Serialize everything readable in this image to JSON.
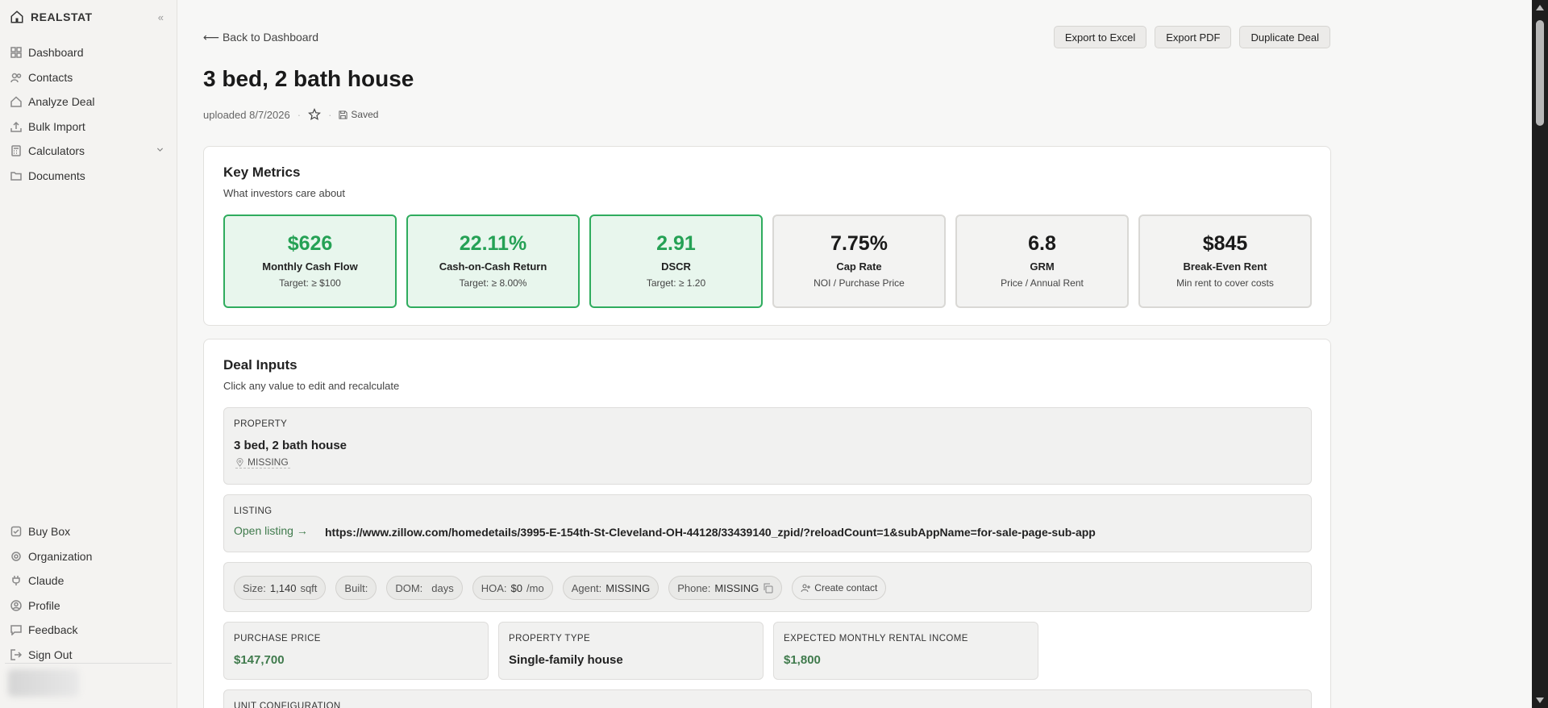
{
  "sidebar": {
    "brand": "REALSTAT",
    "collapse_glyph": "«",
    "top_items": [
      {
        "label": "Dashboard",
        "icon": "grid-icon"
      },
      {
        "label": "Contacts",
        "icon": "users-icon"
      },
      {
        "label": "Analyze Deal",
        "icon": "home-icon"
      },
      {
        "label": "Bulk Import",
        "icon": "upload-icon"
      },
      {
        "label": "Calculators",
        "icon": "calculator-icon"
      },
      {
        "label": "Documents",
        "icon": "folder-icon"
      }
    ],
    "bottom_items": [
      {
        "label": "Buy Box",
        "icon": "checkbox-icon"
      },
      {
        "label": "Organization",
        "icon": "gear-icon"
      },
      {
        "label": "Claude",
        "icon": "plug-icon"
      },
      {
        "label": "Profile",
        "icon": "user-circle-icon"
      },
      {
        "label": "Feedback",
        "icon": "message-icon"
      },
      {
        "label": "Sign Out",
        "icon": "logout-icon"
      }
    ]
  },
  "header": {
    "back": "⟵ Back to Dashboard",
    "buttons": [
      "Export to Excel",
      "Export PDF",
      "Duplicate Deal"
    ],
    "title": "3 bed, 2 bath house",
    "uploaded": "uploaded 8/7/2026",
    "saved": "Saved"
  },
  "key_metrics": {
    "title": "Key Metrics",
    "subtitle": "What investors care about",
    "items": [
      {
        "value": "$626",
        "label": "Monthly Cash Flow",
        "sub": "Target: ≥ $100",
        "status": "good"
      },
      {
        "value": "22.11%",
        "label": "Cash-on-Cash Return",
        "sub": "Target: ≥ 8.00%",
        "status": "good"
      },
      {
        "value": "2.91",
        "label": "DSCR",
        "sub": "Target: ≥ 1.20",
        "status": "good"
      },
      {
        "value": "7.75%",
        "label": "Cap Rate",
        "sub": "NOI / Purchase Price",
        "status": "neutral"
      },
      {
        "value": "6.8",
        "label": "GRM",
        "sub": "Price / Annual Rent",
        "status": "neutral"
      },
      {
        "value": "$845",
        "label": "Break-Even Rent",
        "sub": "Min rent to cover costs",
        "status": "neutral"
      }
    ]
  },
  "deal_inputs": {
    "title": "Deal Inputs",
    "subtitle": "Click any value to edit and recalculate",
    "property": {
      "label": "Property",
      "name": "3 bed, 2 bath house",
      "location": "MISSING"
    },
    "listing": {
      "label": "Listing",
      "open": "Open listing →",
      "url": "https://www.zillow.com/homedetails/3995-E-154th-St-Cleveland-OH-44128/33439140_zpid/?reloadCount=1&subAppName=for-sale-page-sub-app"
    },
    "chips": {
      "size": {
        "key": "Size:",
        "value": "1,140",
        "unit": "sqft"
      },
      "built": {
        "key": "Built:"
      },
      "dom": {
        "key": "DOM:",
        "unit": "days"
      },
      "hoa": {
        "key": "HOA:",
        "value": "$0",
        "unit": "/mo"
      },
      "agent": {
        "key": "Agent:",
        "value": "MISSING"
      },
      "phone": {
        "key": "Phone:",
        "value": "MISSING"
      },
      "create_contact": "Create contact"
    },
    "purchase_price": {
      "label": "Purchase Price",
      "value": "$147,700"
    },
    "property_type": {
      "label": "Property Type",
      "value": "Single-family house"
    },
    "rental_income": {
      "label": "Expected Monthly Rental Income",
      "value": "$1,800"
    },
    "unit_config": {
      "label": "Unit Configuration"
    }
  },
  "colors": {
    "good": "#25a155",
    "good_bg": "#e8f6ed",
    "link_green": "#3f7a4c"
  }
}
